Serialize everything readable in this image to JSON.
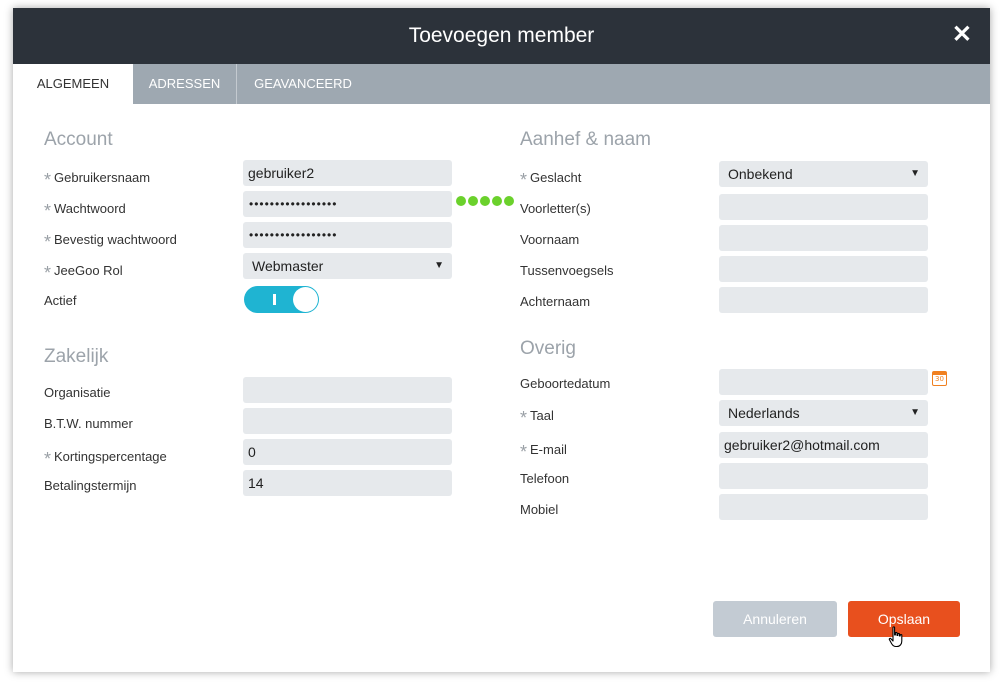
{
  "dialog": {
    "title": "Toevoegen member",
    "close_glyph": "✕"
  },
  "tabs": [
    {
      "label": "ALGEMEEN",
      "active": true
    },
    {
      "label": "ADRESSEN",
      "active": false
    },
    {
      "label": "GEAVANCEERD",
      "active": false
    }
  ],
  "account": {
    "heading": "Account",
    "username_label": "Gebruikersnaam",
    "username_value": "gebruiker2",
    "password_label": "Wachtwoord",
    "password_value": "•••••••••••••••••",
    "password_confirm_label": "Bevestig wachtwoord",
    "password_confirm_value": "•••••••••••••••••",
    "password_strength": 5,
    "role_label": "JeeGoo Rol",
    "role_value": "Webmaster",
    "active_label": "Actief",
    "active_on": true
  },
  "zakelijk": {
    "heading": "Zakelijk",
    "org_label": "Organisatie",
    "org_value": "",
    "vat_label": "B.T.W. nummer",
    "vat_value": "",
    "discount_label": "Kortingspercentage",
    "discount_value": "0",
    "term_label": "Betalingstermijn",
    "term_value": "14"
  },
  "naam": {
    "heading": "Aanhef & naam",
    "gender_label": "Geslacht",
    "gender_value": "Onbekend",
    "initials_label": "Voorletter(s)",
    "firstname_label": "Voornaam",
    "infix_label": "Tussenvoegsels",
    "lastname_label": "Achternaam"
  },
  "overig": {
    "heading": "Overig",
    "birthdate_label": "Geboortedatum",
    "calendar_day": "30",
    "language_label": "Taal",
    "language_value": "Nederlands",
    "email_label": "E-mail",
    "email_value": "gebruiker2@hotmail.com",
    "phone_label": "Telefoon",
    "mobile_label": "Mobiel"
  },
  "required_marker": "*",
  "caret_glyph": "▼",
  "buttons": {
    "cancel": "Annuleren",
    "save": "Opslaan"
  },
  "colors": {
    "titlebar": "#2c323a",
    "tabbar": "#9ea8b1",
    "toggle": "#1fb4d2",
    "save": "#e8501e",
    "strength": "#6bd12c"
  },
  "icons": {
    "close": "close-icon",
    "calendar": "calendar-icon",
    "cursor": "hand-cursor-icon"
  }
}
